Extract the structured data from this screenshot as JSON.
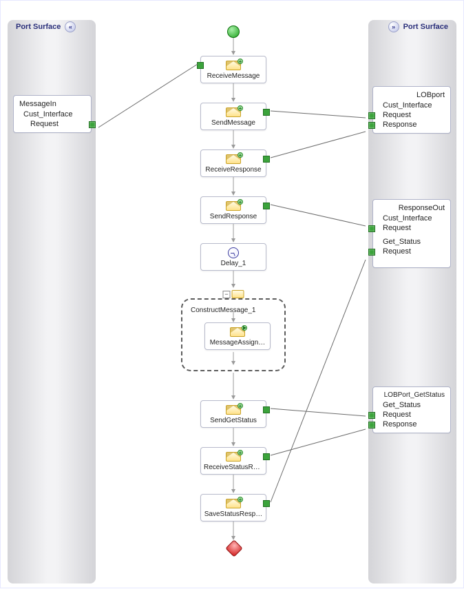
{
  "surfaces": {
    "left": {
      "label": "Port Surface"
    },
    "right": {
      "label": "Port Surface"
    }
  },
  "ports": {
    "left": [
      {
        "name": "MessageIn",
        "operation": "Cust_Interface",
        "messages": [
          {
            "label": "Request",
            "direction": "in"
          }
        ]
      }
    ],
    "right": [
      {
        "name": "LOBport",
        "operation": "Cust_Interface",
        "messages": [
          {
            "label": "Request",
            "direction": "out"
          },
          {
            "label": "Response",
            "direction": "in"
          }
        ]
      },
      {
        "name": "ResponseOut",
        "operations": [
          {
            "name": "Cust_Interface",
            "messages": [
              {
                "label": "Request",
                "direction": "out"
              }
            ]
          },
          {
            "name": "Get_Status",
            "messages": [
              {
                "label": "Request",
                "direction": "out"
              }
            ]
          }
        ]
      },
      {
        "name": "LOBPort_GetStatus",
        "operation": "Get_Status",
        "messages": [
          {
            "label": "Request",
            "direction": "out"
          },
          {
            "label": "Response",
            "direction": "in"
          }
        ]
      }
    ]
  },
  "shapes": [
    {
      "type": "Receive",
      "label": "ReceiveMessage"
    },
    {
      "type": "Send",
      "label": "SendMessage"
    },
    {
      "type": "Receive",
      "label": "ReceiveResponse"
    },
    {
      "type": "Send",
      "label": "SendResponse"
    },
    {
      "type": "Delay",
      "label": "Delay_1"
    },
    {
      "type": "ConstructMessage",
      "label": "ConstructMessage_1",
      "collapsed": false,
      "children": [
        {
          "type": "MessageAssignment",
          "label": "MessageAssign…"
        }
      ]
    },
    {
      "type": "Send",
      "label": "SendGetStatus"
    },
    {
      "type": "Receive",
      "label": "ReceiveStatusRe…"
    },
    {
      "type": "Send",
      "label": "SaveStatusResp…"
    }
  ],
  "connections": [
    {
      "from": "MessageIn.Cust_Interface.Request",
      "to": "ReceiveMessage"
    },
    {
      "from": "SendMessage",
      "to": "LOBport.Cust_Interface.Request"
    },
    {
      "from": "LOBport.Cust_Interface.Response",
      "to": "ReceiveResponse"
    },
    {
      "from": "SendResponse",
      "to": "ResponseOut.Cust_Interface.Request"
    },
    {
      "from": "SendGetStatus",
      "to": "LOBPort_GetStatus.Get_Status.Request"
    },
    {
      "from": "LOBPort_GetStatus.Get_Status.Response",
      "to": "ReceiveStatusRe…"
    },
    {
      "from": "SaveStatusResp…",
      "to": "ResponseOut.Get_Status.Request"
    }
  ],
  "flow_sequence": [
    "Start",
    "ReceiveMessage",
    "SendMessage",
    "ReceiveResponse",
    "SendResponse",
    "Delay_1",
    "ConstructMessage_1",
    "SendGetStatus",
    "ReceiveStatusRe…",
    "SaveStatusResp…",
    "End"
  ]
}
